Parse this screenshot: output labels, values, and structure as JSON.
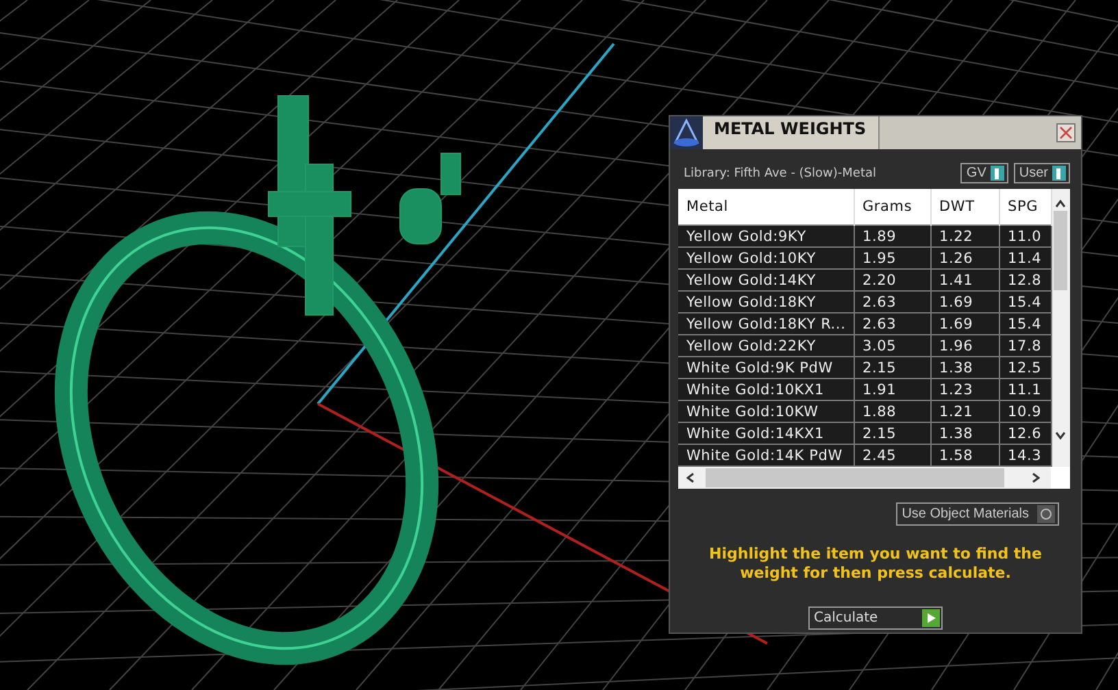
{
  "window": {
    "title": "METAL WEIGHTS"
  },
  "library": "Library: Fifth Ave - (Slow)-Metal",
  "toggles": [
    {
      "label": "GV",
      "on": true
    },
    {
      "label": "User",
      "on": true
    }
  ],
  "table": {
    "columns": [
      "Metal",
      "Grams",
      "DWT",
      "SPG"
    ],
    "rows": [
      [
        "Yellow Gold:9KY",
        "1.89",
        "1.22",
        "11.0"
      ],
      [
        "Yellow Gold:10KY",
        "1.95",
        "1.26",
        "11.4"
      ],
      [
        "Yellow Gold:14KY",
        "2.20",
        "1.41",
        "12.8"
      ],
      [
        "Yellow Gold:18KY",
        "2.63",
        "1.69",
        "15.4"
      ],
      [
        "Yellow Gold:18KY R...",
        "2.63",
        "1.69",
        "15.4"
      ],
      [
        "Yellow Gold:22KY",
        "3.05",
        "1.96",
        "17.8"
      ],
      [
        "White Gold:9K PdW",
        "2.15",
        "1.38",
        "12.5"
      ],
      [
        "White Gold:10KX1",
        "1.91",
        "1.23",
        "11.1"
      ],
      [
        "White Gold:10KW",
        "1.88",
        "1.21",
        "10.9"
      ],
      [
        "White Gold:14KX1",
        "2.15",
        "1.38",
        "12.6"
      ],
      [
        "White Gold:14K PdW",
        "2.45",
        "1.58",
        "14.3"
      ]
    ]
  },
  "use_object_materials": {
    "label": "Use Object Materials",
    "on": false
  },
  "hint": "Highlight the item you want to find the weight for then press calculate.",
  "calculate_button": "Calculate"
}
